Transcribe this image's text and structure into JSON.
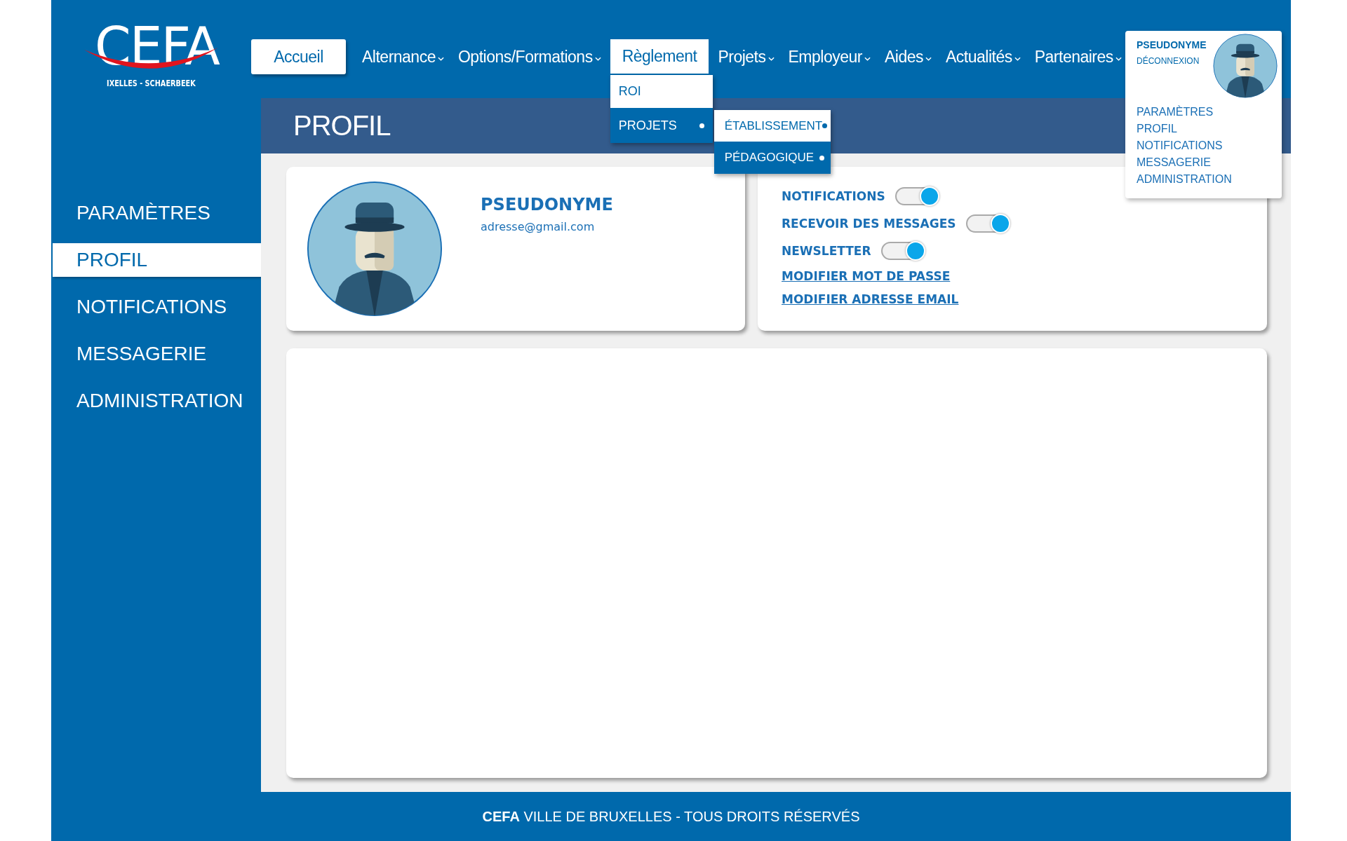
{
  "logo": {
    "name": "CEFA",
    "subtitle": "IXELLES - SCHAERBEEK"
  },
  "nav": [
    {
      "label": "Accueil",
      "selected": true,
      "caret": false,
      "expanded": false
    },
    {
      "label": "Alternance",
      "selected": false,
      "caret": true,
      "expanded": false
    },
    {
      "label": "Options/Formations",
      "selected": false,
      "caret": true,
      "expanded": false
    },
    {
      "label": "Règlement",
      "selected": false,
      "caret": false,
      "expanded": true,
      "menu": [
        {
          "label": "ROI",
          "selected": false
        },
        {
          "label": "PROJETS",
          "selected": true,
          "submenu": [
            {
              "label": "ÉTABLISSEMENT",
              "selected": false
            },
            {
              "label": "PÉDAGOGIQUE",
              "selected": true
            }
          ]
        }
      ]
    },
    {
      "label": "Projets",
      "selected": false,
      "caret": true,
      "expanded": false
    },
    {
      "label": "Employeur",
      "selected": false,
      "caret": true,
      "expanded": false
    },
    {
      "label": "Aides",
      "selected": false,
      "caret": true,
      "expanded": false
    },
    {
      "label": "Actualités",
      "selected": false,
      "caret": true,
      "expanded": false
    },
    {
      "label": "Partenaires",
      "selected": false,
      "caret": true,
      "expanded": false
    }
  ],
  "user_menu": {
    "name": "PSEUDONYME",
    "logout": "DÉCONNEXION",
    "items": [
      "PARAMÈTRES",
      "PROFIL",
      "NOTIFICATIONS",
      "MESSAGERIE",
      "ADMINISTRATION"
    ]
  },
  "page_title": "PROFIL",
  "sidebar": {
    "items": [
      {
        "label": "PARAMÈTRES",
        "selected": false
      },
      {
        "label": "PROFIL",
        "selected": true
      },
      {
        "label": "NOTIFICATIONS",
        "selected": false
      },
      {
        "label": "MESSAGERIE",
        "selected": false
      },
      {
        "label": "ADMINISTRATION",
        "selected": false
      }
    ]
  },
  "profile": {
    "name": "PSEUDONYME",
    "email": "adresse@gmail.com"
  },
  "settings": {
    "toggles": [
      {
        "label": "NOTIFICATIONS",
        "on": true
      },
      {
        "label": "RECEVOIR DES MESSAGES",
        "on": true
      },
      {
        "label": "NEWSLETTER",
        "on": true
      }
    ],
    "links": [
      "MODIFIER MOT DE PASSE",
      "MODIFIER ADRESSE EMAIL"
    ]
  },
  "footer": "**CEFA** VILLE DE BRUXELLES - TOUS DROITS RÉSERVÉS"
}
